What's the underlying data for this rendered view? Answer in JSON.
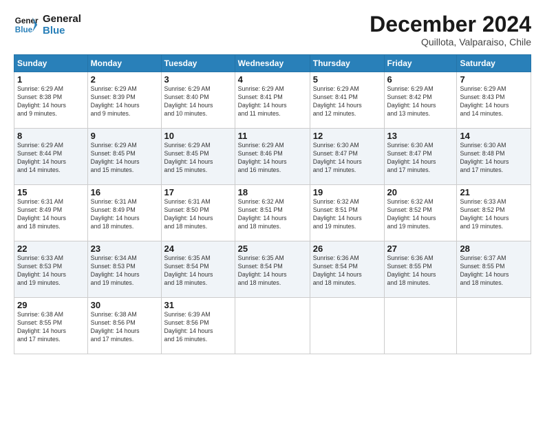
{
  "logo": {
    "line1": "General",
    "line2": "Blue"
  },
  "title": "December 2024",
  "subtitle": "Quillota, Valparaiso, Chile",
  "days_of_week": [
    "Sunday",
    "Monday",
    "Tuesday",
    "Wednesday",
    "Thursday",
    "Friday",
    "Saturday"
  ],
  "weeks": [
    [
      {
        "day": "1",
        "sunrise": "6:29 AM",
        "sunset": "8:38 PM",
        "daylight": "14 hours and 9 minutes."
      },
      {
        "day": "2",
        "sunrise": "6:29 AM",
        "sunset": "8:39 PM",
        "daylight": "14 hours and 9 minutes."
      },
      {
        "day": "3",
        "sunrise": "6:29 AM",
        "sunset": "8:40 PM",
        "daylight": "14 hours and 10 minutes."
      },
      {
        "day": "4",
        "sunrise": "6:29 AM",
        "sunset": "8:41 PM",
        "daylight": "14 hours and 11 minutes."
      },
      {
        "day": "5",
        "sunrise": "6:29 AM",
        "sunset": "8:41 PM",
        "daylight": "14 hours and 12 minutes."
      },
      {
        "day": "6",
        "sunrise": "6:29 AM",
        "sunset": "8:42 PM",
        "daylight": "14 hours and 13 minutes."
      },
      {
        "day": "7",
        "sunrise": "6:29 AM",
        "sunset": "8:43 PM",
        "daylight": "14 hours and 14 minutes."
      }
    ],
    [
      {
        "day": "8",
        "sunrise": "6:29 AM",
        "sunset": "8:44 PM",
        "daylight": "14 hours and 14 minutes."
      },
      {
        "day": "9",
        "sunrise": "6:29 AM",
        "sunset": "8:45 PM",
        "daylight": "14 hours and 15 minutes."
      },
      {
        "day": "10",
        "sunrise": "6:29 AM",
        "sunset": "8:45 PM",
        "daylight": "14 hours and 15 minutes."
      },
      {
        "day": "11",
        "sunrise": "6:29 AM",
        "sunset": "8:46 PM",
        "daylight": "14 hours and 16 minutes."
      },
      {
        "day": "12",
        "sunrise": "6:30 AM",
        "sunset": "8:47 PM",
        "daylight": "14 hours and 17 minutes."
      },
      {
        "day": "13",
        "sunrise": "6:30 AM",
        "sunset": "8:47 PM",
        "daylight": "14 hours and 17 minutes."
      },
      {
        "day": "14",
        "sunrise": "6:30 AM",
        "sunset": "8:48 PM",
        "daylight": "14 hours and 17 minutes."
      }
    ],
    [
      {
        "day": "15",
        "sunrise": "6:31 AM",
        "sunset": "8:49 PM",
        "daylight": "14 hours and 18 minutes."
      },
      {
        "day": "16",
        "sunrise": "6:31 AM",
        "sunset": "8:49 PM",
        "daylight": "14 hours and 18 minutes."
      },
      {
        "day": "17",
        "sunrise": "6:31 AM",
        "sunset": "8:50 PM",
        "daylight": "14 hours and 18 minutes."
      },
      {
        "day": "18",
        "sunrise": "6:32 AM",
        "sunset": "8:51 PM",
        "daylight": "14 hours and 18 minutes."
      },
      {
        "day": "19",
        "sunrise": "6:32 AM",
        "sunset": "8:51 PM",
        "daylight": "14 hours and 19 minutes."
      },
      {
        "day": "20",
        "sunrise": "6:32 AM",
        "sunset": "8:52 PM",
        "daylight": "14 hours and 19 minutes."
      },
      {
        "day": "21",
        "sunrise": "6:33 AM",
        "sunset": "8:52 PM",
        "daylight": "14 hours and 19 minutes."
      }
    ],
    [
      {
        "day": "22",
        "sunrise": "6:33 AM",
        "sunset": "8:53 PM",
        "daylight": "14 hours and 19 minutes."
      },
      {
        "day": "23",
        "sunrise": "6:34 AM",
        "sunset": "8:53 PM",
        "daylight": "14 hours and 19 minutes."
      },
      {
        "day": "24",
        "sunrise": "6:35 AM",
        "sunset": "8:54 PM",
        "daylight": "14 hours and 18 minutes."
      },
      {
        "day": "25",
        "sunrise": "6:35 AM",
        "sunset": "8:54 PM",
        "daylight": "14 hours and 18 minutes."
      },
      {
        "day": "26",
        "sunrise": "6:36 AM",
        "sunset": "8:54 PM",
        "daylight": "14 hours and 18 minutes."
      },
      {
        "day": "27",
        "sunrise": "6:36 AM",
        "sunset": "8:55 PM",
        "daylight": "14 hours and 18 minutes."
      },
      {
        "day": "28",
        "sunrise": "6:37 AM",
        "sunset": "8:55 PM",
        "daylight": "14 hours and 18 minutes."
      }
    ],
    [
      {
        "day": "29",
        "sunrise": "6:38 AM",
        "sunset": "8:55 PM",
        "daylight": "14 hours and 17 minutes."
      },
      {
        "day": "30",
        "sunrise": "6:38 AM",
        "sunset": "8:56 PM",
        "daylight": "14 hours and 17 minutes."
      },
      {
        "day": "31",
        "sunrise": "6:39 AM",
        "sunset": "8:56 PM",
        "daylight": "14 hours and 16 minutes."
      },
      null,
      null,
      null,
      null
    ]
  ],
  "labels": {
    "sunrise": "Sunrise:",
    "sunset": "Sunset:",
    "daylight": "Daylight:"
  }
}
